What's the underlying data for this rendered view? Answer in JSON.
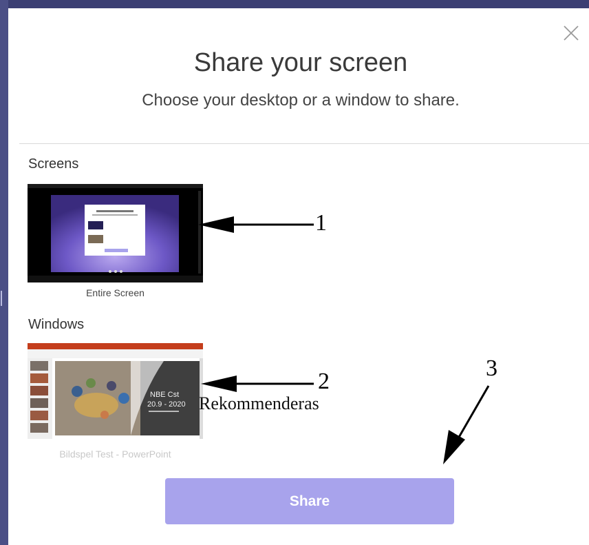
{
  "dialog": {
    "title": "Share your screen",
    "subtitle": "Choose your desktop or a window to share."
  },
  "sections": {
    "screens": {
      "label": "Screens",
      "items": [
        {
          "caption": "Entire Screen"
        }
      ]
    },
    "windows": {
      "label": "Windows",
      "items": [
        {
          "caption": "Bildspel Test - PowerPoint",
          "slide_text_line1": "NBE Cst",
          "slide_text_line2": "20.9 - 2020"
        }
      ]
    }
  },
  "share_button": {
    "label": "Share"
  },
  "annotations": {
    "arrow_1": "1",
    "arrow_2": "2",
    "arrow_3": "3",
    "recommended_label": "Rekommenderas"
  },
  "colors": {
    "accent": "#a8a3ec",
    "frame": "#3b3f73",
    "title_text": "#3a3a3a",
    "muted_caption": "#c8c8c8",
    "powerpoint_red": "#c43e1c"
  },
  "icons": {
    "close": "close-icon"
  }
}
